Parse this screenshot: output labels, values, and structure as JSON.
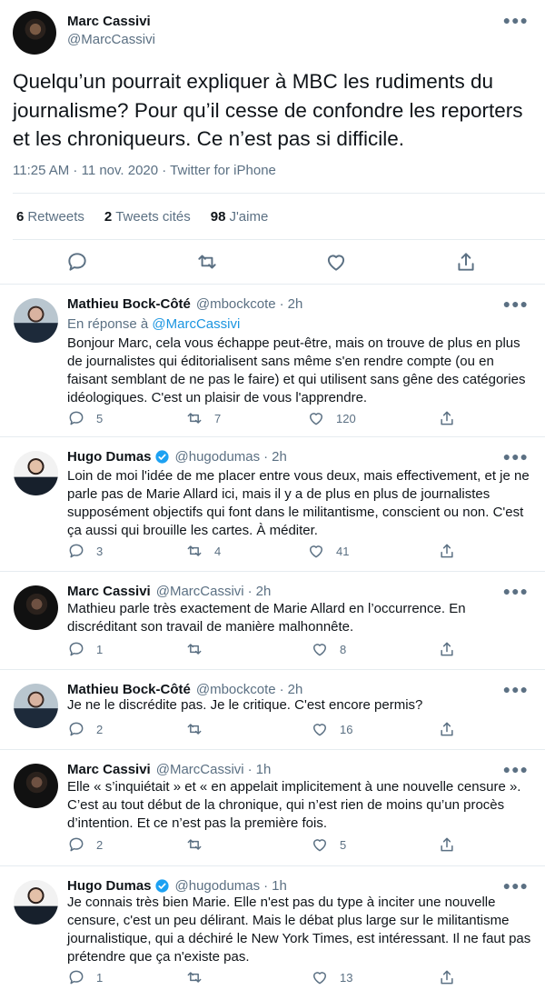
{
  "main_tweet": {
    "name": "Marc Cassivi",
    "handle": "@MarcCassivi",
    "text": "Quelqu’un pourrait expliquer à MBC les rudiments du journalisme? Pour qu’il cesse de confondre les reporters et les chroniqueurs. Ce n’est pas si difficile.",
    "timestamp": "11:25 AM · 11 nov. 2020 · Twitter for iPhone",
    "stats": {
      "retweets_count": "6",
      "retweets_label": "Retweets",
      "quotes_count": "2",
      "quotes_label": "Tweets cités",
      "likes_count": "98",
      "likes_label": "J'aime"
    }
  },
  "replies": [
    {
      "name": "Mathieu Bock-Côté",
      "handle": "@mbockcote",
      "time": "2h",
      "in_reply_prefix": "En réponse à",
      "in_reply_handle": "@MarcCassivi",
      "text": "Bonjour Marc, cela vous échappe peut-être, mais on trouve de plus en plus de journalistes qui éditorialisent sans même s'en rendre compte (ou en faisant semblant de ne pas le faire) et qui utilisent sans gêne des catégories idéologiques. C'est un plaisir de vous l'apprendre.",
      "replies": "5",
      "retweets": "7",
      "likes": "120"
    },
    {
      "name": "Hugo Dumas",
      "handle": "@hugodumas",
      "time": "2h",
      "text": "Loin de moi l'idée de me placer entre vous deux, mais effectivement, et je ne parle pas de Marie Allard ici, mais il y a de plus en plus de journalistes supposément objectifs qui font dans le militantisme, conscient ou non. C'est ça aussi qui brouille les cartes. À méditer.",
      "replies": "3",
      "retweets": "4",
      "likes": "41"
    },
    {
      "name": "Marc Cassivi",
      "handle": "@MarcCassivi",
      "time": "2h",
      "text": "Mathieu parle très exactement de Marie Allard en l’occurrence. En discréditant son travail de manière malhonnête.",
      "replies": "1",
      "retweets": "",
      "likes": "8"
    },
    {
      "name": "Mathieu Bock-Côté",
      "handle": "@mbockcote",
      "time": "2h",
      "text": "Je ne le discrédite pas. Je le critique. C'est encore permis?",
      "replies": "2",
      "retweets": "",
      "likes": "16"
    },
    {
      "name": "Marc Cassivi",
      "handle": "@MarcCassivi",
      "time": "1h",
      "text": "Elle « s’inquiétait » et « en appelait implicitement à une nouvelle censure ». C’est au tout début de la chronique, qui n’est rien de moins qu’un procès d’intention. Et ce n’est pas la première fois.",
      "replies": "2",
      "retweets": "",
      "likes": "5"
    },
    {
      "name": "Hugo Dumas",
      "handle": "@hugodumas",
      "time": "1h",
      "text": "Je connais très bien Marie. Elle n'est pas du type à inciter une nouvelle censure, c'est un peu délirant. Mais le débat plus large sur le militantisme journalistique, qui a déchiré le New York Times, est intéressant. Il ne faut pas prétendre que ça n'existe pas.",
      "replies": "1",
      "retweets": "",
      "likes": "13"
    }
  ],
  "colors": {
    "link": "#1b95e0",
    "muted": "#5b7083",
    "text": "#0f1419",
    "verified": "#1da1f2"
  },
  "icons": [
    "more-icon",
    "reply-icon",
    "retweet-icon",
    "like-icon",
    "share-icon",
    "verified-icon"
  ]
}
